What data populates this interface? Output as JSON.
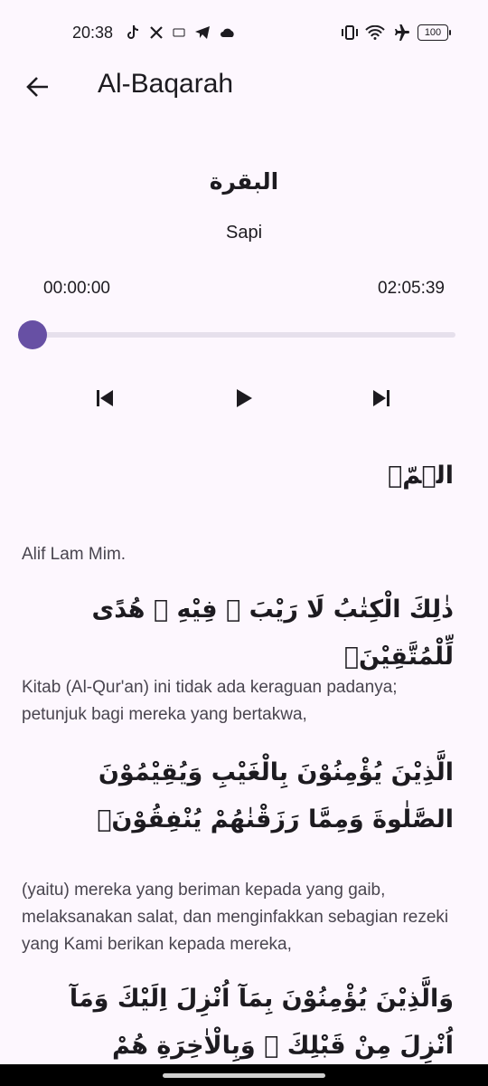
{
  "status": {
    "time": "20:38",
    "battery": "100"
  },
  "header": {
    "title": "Al-Baqarah"
  },
  "surah": {
    "arabic_name": "البقرة",
    "meaning": "Sapi"
  },
  "player": {
    "current_time": "00:00:00",
    "total_time": "02:05:39",
    "progress_percent": 0
  },
  "verses": [
    {
      "arabic": "الۤمّۤ",
      "translation": "Alif Lam Mim."
    },
    {
      "arabic": "ذٰلِكَ الْكِتٰبُ لَا رَيْبَ ۛ فِيْهِ ۛ هُدًى لِّلْمُتَّقِيْنَۙ",
      "translation": "Kitab (Al-Qur'an) ini tidak ada keraguan padanya; petunjuk bagi mereka yang bertakwa,"
    },
    {
      "arabic": "الَّذِيْنَ يُؤْمِنُوْنَ بِالْغَيْبِ وَيُقِيْمُوْنَ الصَّلٰوةَ وَمِمَّا رَزَقْنٰهُمْ يُنْفِقُوْنَۙ",
      "translation": "(yaitu) mereka yang beriman kepada yang gaib, melaksanakan salat, dan menginfakkan sebagian rezeki yang Kami berikan kepada mereka,"
    },
    {
      "arabic": "وَالَّذِيْنَ يُؤْمِنُوْنَ بِمَآ اُنْزِلَ اِلَيْكَ وَمَآ اُنْزِلَ مِنْ قَبْلِكَ ۚ وَبِالْاٰخِرَةِ هُمْ يُوْقِنُوْنَۗ",
      "translation": ""
    }
  ]
}
